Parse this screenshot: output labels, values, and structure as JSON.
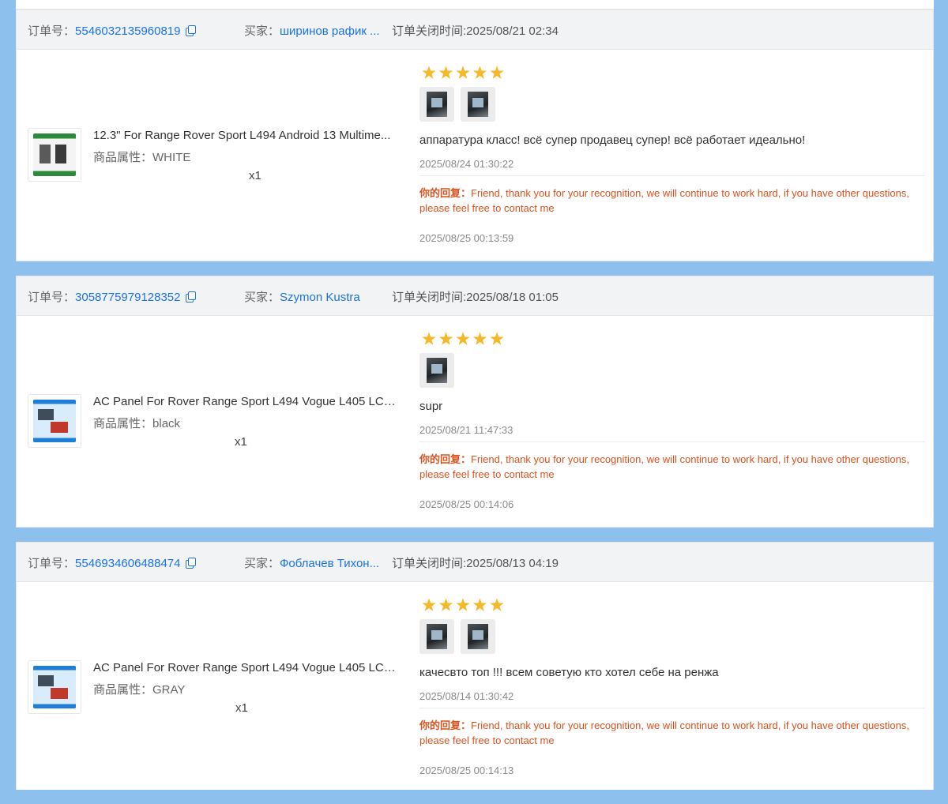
{
  "labels": {
    "order_no": "订单号：",
    "buyer": "买家：",
    "close_time": "订单关闭时间:",
    "attr": "商品属性：",
    "reply": "你的回复："
  },
  "orders": [
    {
      "order_number": "5546032135960819",
      "buyer": "ширинов рафик ...",
      "close_time": "2025/08/21 02:34",
      "product_title": "12.3\" For Range Rover Sport L494 Android 13 Multime...",
      "product_attr": "WHITE",
      "qty": "x1",
      "rating": 5,
      "photo_count": 2,
      "review_text": "аппаратура класс! всё супер продавец супер! всё работает идеально!",
      "review_time": "2025/08/24 01:30:22",
      "reply_text": "Friend, thank you for your recognition, we will continue to work hard, if you have other questions, please feel free to contact me",
      "reply_time": "2025/08/25 00:13:59"
    },
    {
      "order_number": "3058775979128352",
      "buyer": "Szymon Kustra",
      "close_time": "2025/08/18 01:05",
      "product_title": "AC Panel For Rover Range Sport L494 Vogue L405 LCD...",
      "product_attr": "black",
      "qty": "x1",
      "rating": 5,
      "photo_count": 1,
      "review_text": "supr",
      "review_time": "2025/08/21 11:47:33",
      "reply_text": "Friend, thank you for your recognition, we will continue to work hard, if you have other questions, please feel free to contact me",
      "reply_time": "2025/08/25 00:14:06"
    },
    {
      "order_number": "5546934606488474",
      "buyer": "Фоблачев Тихон...",
      "close_time": "2025/08/13 04:19",
      "product_title": "AC Panel For Rover Range Sport L494 Vogue L405 LCD...",
      "product_attr": "GRAY",
      "qty": "x1",
      "rating": 5,
      "photo_count": 2,
      "review_text": "качесвто топ !!! всем советую кто хотел себе на ренжа",
      "review_time": "2025/08/14 01:30:42",
      "reply_text": "Friend, thank you for your recognition, we will continue to work hard, if you have other questions, please feel free to contact me",
      "reply_time": "2025/08/25 00:14:13"
    }
  ],
  "colors": {
    "background": "#8ec0ee",
    "link": "#1a73e8",
    "star": "#f6b728",
    "reply": "#d9531e"
  }
}
